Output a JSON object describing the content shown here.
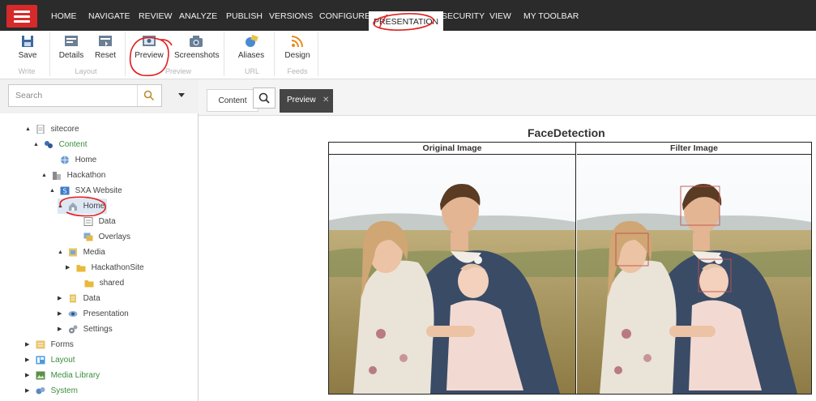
{
  "topnav": {
    "items": [
      "HOME",
      "NAVIGATE",
      "REVIEW",
      "ANALYZE",
      "PUBLISH",
      "VERSIONS",
      "CONFIGURE",
      "PRESENTATION",
      "SECURITY",
      "VIEW",
      "MY TOOLBAR"
    ],
    "active": "PRESENTATION"
  },
  "ribbon": {
    "buttons": [
      {
        "label": "Save",
        "icon": "save-icon"
      },
      {
        "label": "Details",
        "icon": "details-icon"
      },
      {
        "label": "Reset",
        "icon": "reset-icon"
      },
      {
        "label": "Preview",
        "icon": "preview-icon"
      },
      {
        "label": "Screenshots",
        "icon": "camera-icon"
      },
      {
        "label": "Aliases",
        "icon": "aliases-icon"
      },
      {
        "label": "Design",
        "icon": "rss-icon"
      }
    ],
    "groups": [
      "Write",
      "Layout",
      "Preview",
      "URL",
      "Feeds"
    ]
  },
  "search": {
    "placeholder": "Search"
  },
  "tree": [
    {
      "label": "sitecore",
      "toggle": "▲",
      "icon": "page-icon"
    },
    {
      "label": "Content",
      "toggle": "▲",
      "icon": "content-icon"
    },
    {
      "label": "Home",
      "toggle": "",
      "icon": "home-globe-icon"
    },
    {
      "label": "Hackathon",
      "toggle": "▲",
      "icon": "tenant-icon"
    },
    {
      "label": "SXA Website",
      "toggle": "▲",
      "icon": "site-icon"
    },
    {
      "label": "Home",
      "toggle": "▲",
      "icon": "home-icon"
    },
    {
      "label": "Data",
      "toggle": "",
      "icon": "data-icon"
    },
    {
      "label": "Overlays",
      "toggle": "",
      "icon": "overlays-icon"
    },
    {
      "label": "Media",
      "toggle": "▲",
      "icon": "media-icon"
    },
    {
      "label": "HackathonSite",
      "toggle": "▶",
      "icon": "folder-icon"
    },
    {
      "label": "shared",
      "toggle": "",
      "icon": "folder-icon"
    },
    {
      "label": "Data",
      "toggle": "▶",
      "icon": "data-folder-icon"
    },
    {
      "label": "Presentation",
      "toggle": "▶",
      "icon": "eye-icon"
    },
    {
      "label": "Settings",
      "toggle": "▶",
      "icon": "settings-icon"
    },
    {
      "label": "Forms",
      "toggle": "▶",
      "icon": "forms-icon"
    },
    {
      "label": "Layout",
      "toggle": "▶",
      "icon": "layout-icon"
    },
    {
      "label": "Media Library",
      "toggle": "▶",
      "icon": "media-library-icon"
    },
    {
      "label": "System",
      "toggle": "▶",
      "icon": "system-icon"
    }
  ],
  "tabs": {
    "content": "Content",
    "preview": "Preview",
    "close": "✕"
  },
  "preview": {
    "title": "FaceDetection",
    "col1": "Original Image",
    "col2": "Filter Image"
  },
  "colors": {
    "topnav": "#2b2b2b",
    "brand_red": "#d62a2a",
    "tree_green": "#3b8e3e",
    "tab_dark": "#454545",
    "annotation": "#e02020"
  }
}
